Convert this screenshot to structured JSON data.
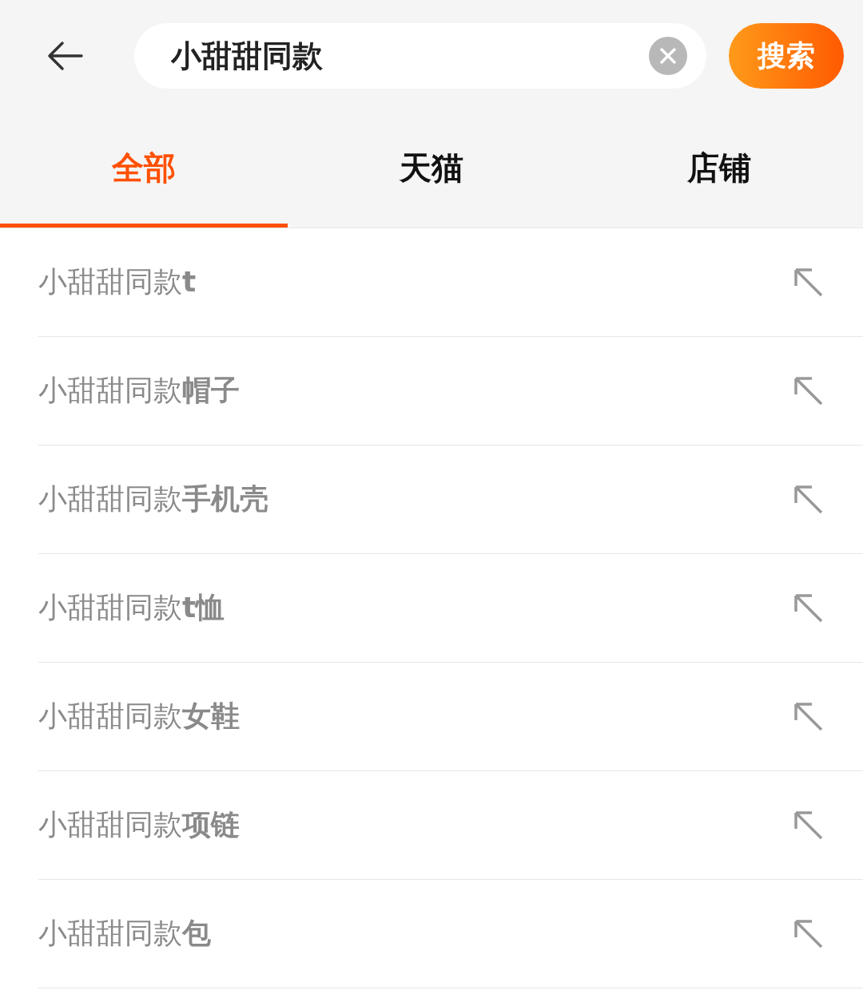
{
  "search": {
    "value": "小甜甜同款",
    "button": "搜索"
  },
  "tabs": [
    {
      "label": "全部",
      "selected": true
    },
    {
      "label": "天猫",
      "selected": false
    },
    {
      "label": "店铺",
      "selected": false
    }
  ],
  "suggestions": [
    {
      "text": "小甜甜同款**t**"
    },
    {
      "text": "小甜甜同款**帽子**"
    },
    {
      "text": "小甜甜同款**手机壳**"
    },
    {
      "text": "小甜甜同款**t恤**"
    },
    {
      "text": "小甜甜同款**女鞋**"
    },
    {
      "text": "小甜甜同款**项链**"
    },
    {
      "text": "小甜甜同款**包**"
    }
  ]
}
